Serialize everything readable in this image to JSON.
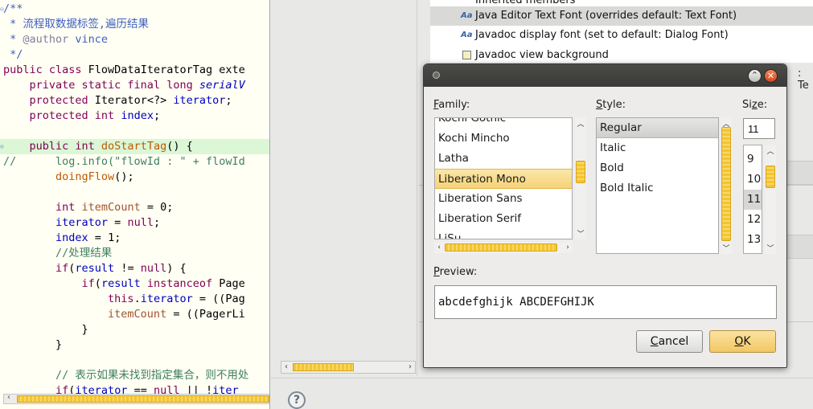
{
  "editor": {
    "lines": [
      [
        {
          "t": "/**",
          "c": "jd"
        }
      ],
      [
        {
          "t": " * 流程取数据标签,遍历结果",
          "c": "jd"
        }
      ],
      [
        {
          "t": " * ",
          "c": "jd"
        },
        {
          "t": "@author",
          "c": "an"
        },
        {
          "t": " vince",
          "c": "jd"
        }
      ],
      [
        {
          "t": " */",
          "c": "jd"
        }
      ],
      [
        {
          "t": "public class ",
          "c": "kw"
        },
        {
          "t": "FlowDataIteratorTag exte",
          "c": "pl"
        }
      ],
      [
        {
          "t": "    private static final long ",
          "c": "kw"
        },
        {
          "t": "serialV",
          "c": "sfi"
        }
      ],
      [
        {
          "t": "    protected ",
          "c": "kw"
        },
        {
          "t": "Iterator<?> ",
          "c": "pl"
        },
        {
          "t": "iterator",
          "c": "fi"
        },
        {
          "t": ";",
          "c": "pl"
        }
      ],
      [
        {
          "t": "    protected int ",
          "c": "kw"
        },
        {
          "t": "index",
          "c": "fi"
        },
        {
          "t": ";",
          "c": "pl"
        }
      ],
      [],
      [
        {
          "t": "    public int ",
          "c": "kw"
        },
        {
          "t": "doStartTag",
          "c": "md"
        },
        {
          "t": "() {",
          "c": "pl"
        }
      ],
      [
        {
          "t": "//      log.info(\"flowId : \" + flowId",
          "c": "cm"
        }
      ],
      [
        {
          "t": "        ",
          "c": "pl"
        },
        {
          "t": "doingFlow",
          "c": "md"
        },
        {
          "t": "();",
          "c": "pl"
        }
      ],
      [],
      [
        {
          "t": "        int ",
          "c": "kw"
        },
        {
          "t": "itemCount",
          "c": "nm"
        },
        {
          "t": " = ",
          "c": "pl"
        },
        {
          "t": "0",
          "c": "pl"
        },
        {
          "t": ";",
          "c": "pl"
        }
      ],
      [
        {
          "t": "        iterator",
          "c": "fi"
        },
        {
          "t": " = ",
          "c": "pl"
        },
        {
          "t": "null",
          "c": "kw"
        },
        {
          "t": ";",
          "c": "pl"
        }
      ],
      [
        {
          "t": "        index",
          "c": "fi"
        },
        {
          "t": " = ",
          "c": "pl"
        },
        {
          "t": "1",
          "c": "pl"
        },
        {
          "t": ";",
          "c": "pl"
        }
      ],
      [
        {
          "t": "        //处理结果",
          "c": "cm"
        }
      ],
      [
        {
          "t": "        if",
          "c": "kw"
        },
        {
          "t": "(",
          "c": "pl"
        },
        {
          "t": "result",
          "c": "fi"
        },
        {
          "t": " != ",
          "c": "pl"
        },
        {
          "t": "null",
          "c": "kw"
        },
        {
          "t": ") {",
          "c": "pl"
        }
      ],
      [
        {
          "t": "            if",
          "c": "kw"
        },
        {
          "t": "(",
          "c": "pl"
        },
        {
          "t": "result",
          "c": "fi"
        },
        {
          "t": " instanceof ",
          "c": "kw"
        },
        {
          "t": "Page",
          "c": "pl"
        }
      ],
      [
        {
          "t": "                this",
          "c": "kw"
        },
        {
          "t": ".",
          "c": "pl"
        },
        {
          "t": "iterator",
          "c": "fi"
        },
        {
          "t": " = ((Pag",
          "c": "pl"
        }
      ],
      [
        {
          "t": "                itemCount",
          "c": "nm"
        },
        {
          "t": " = ((PagerLi",
          "c": "pl"
        }
      ],
      [
        {
          "t": "            }",
          "c": "pl"
        }
      ],
      [
        {
          "t": "        }",
          "c": "pl"
        }
      ],
      [],
      [
        {
          "t": "        // 表示如果未找到指定集合，则不用处",
          "c": "cm"
        }
      ],
      [
        {
          "t": "        if",
          "c": "kw"
        },
        {
          "t": "(",
          "c": "pl"
        },
        {
          "t": "iterator",
          "c": "fi"
        },
        {
          "t": " == ",
          "c": "pl"
        },
        {
          "t": "null",
          "c": "kw"
        },
        {
          "t": " || !",
          "c": "pl"
        },
        {
          "t": "iter",
          "c": "fi"
        }
      ]
    ],
    "highlighted_line": 9,
    "marker_lines": [
      0,
      9
    ]
  },
  "prefs": {
    "color_items": [
      {
        "label": "Inherited members",
        "icon": "color-swatch"
      },
      {
        "label": "Java Editor Text Font (overrides default: Text Font)",
        "icon": "font-aa"
      },
      {
        "label": "Javadoc display font (set to default: Dialog Font)",
        "icon": "font-aa"
      },
      {
        "label": "Javadoc view background",
        "icon": "color-swatch"
      }
    ],
    "selected_item": 1,
    "right_edge_text": ": Te",
    "help_label": "?"
  },
  "dialog": {
    "family_label": "Family:",
    "family_mnemonic": "F",
    "style_label": "Style:",
    "style_mnemonic": "S",
    "size_label": "Size:",
    "size_mnemonic": "z",
    "families": [
      "Kochi Gothic",
      "Kochi Mincho",
      "Latha",
      "Liberation Mono",
      "Liberation Sans",
      "Liberation Serif",
      "LiSu"
    ],
    "selected_family": "Liberation Mono",
    "styles": [
      "Regular",
      "Italic",
      "Bold",
      "Bold Italic"
    ],
    "selected_style": "Regular",
    "size_value": "11",
    "sizes": [
      "9",
      "10",
      "11",
      "12",
      "13"
    ],
    "selected_size": "11",
    "preview_label": "Preview:",
    "preview_mnemonic": "P",
    "preview_text": "abcdefghijk ABCDEFGHIJK",
    "cancel_label": "Cancel",
    "ok_label": "OK"
  },
  "colors": {
    "selection_yellow": "#f6d27a",
    "scroll_thumb": "#f4c430",
    "current_line": "#dbf7d6",
    "editor_bg": "#fffff4"
  }
}
